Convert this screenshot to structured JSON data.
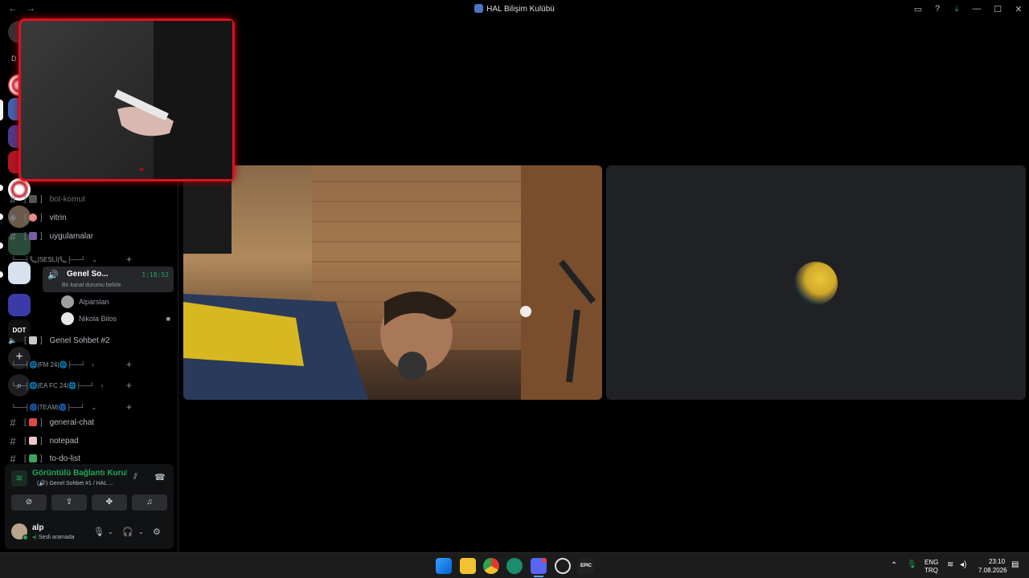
{
  "window": {
    "title": "HAL Bilişim Kulübü",
    "nav_back": "←",
    "nav_forward": "→"
  },
  "guild_rail": {
    "dm_label": "D",
    "items": [
      "guild-1",
      "guild-2",
      "guild-3",
      "guild-4",
      "guild-5",
      "guild-6",
      "guild-7",
      "guild-8",
      "guild-9"
    ],
    "dot_label": "DOT",
    "add_icon": "+",
    "discover_icon": "⌕"
  },
  "channels": {
    "text_channels_top": [
      {
        "name": "bot-komut",
        "icon": "robot-icon"
      },
      {
        "name": "vitrin",
        "icon": "brain-icon"
      },
      {
        "name": "uygulamalar",
        "icon": "apps-icon"
      }
    ],
    "category_sesli": "└──┤📞|SESLİ|📞├──┘",
    "active_voice": {
      "name": "Genel So...",
      "time": "1:18:52",
      "status": "Bir kanal durumu belirle"
    },
    "members": [
      {
        "name": "Alparslan"
      },
      {
        "name": "Nikola Bilos"
      }
    ],
    "voice_2": "Genel Sohbet #2",
    "category_fm": "└──┤🌐|FM 24|🌐├──┘",
    "category_eafc": "└──┤🌐|EA FC 24|🌐├──┘",
    "category_team": "└──┤🌀|TEAM|🌀├──┘",
    "text_channels_bottom": [
      {
        "name": "general-chat"
      },
      {
        "name": "notepad"
      },
      {
        "name": "to-do-list"
      }
    ]
  },
  "voice_panel": {
    "status": "Görüntülü Bağlantı Kuruld",
    "sub": "Genel Sohbet #1 / HAL ...",
    "buttons": [
      "camera-off",
      "screen-share",
      "activities",
      "soundboard"
    ]
  },
  "user": {
    "name": "alp",
    "status": "Sesli aramada"
  },
  "taskbar": {
    "lang_1": "ENG",
    "lang_2": "TRQ",
    "time": "23:10",
    "date": "7.08.2026",
    "epic_label": "EPIC"
  },
  "colors": {
    "accent_green": "#23a55a",
    "popout_border": "#e01020",
    "panel_bg": "#111214"
  }
}
